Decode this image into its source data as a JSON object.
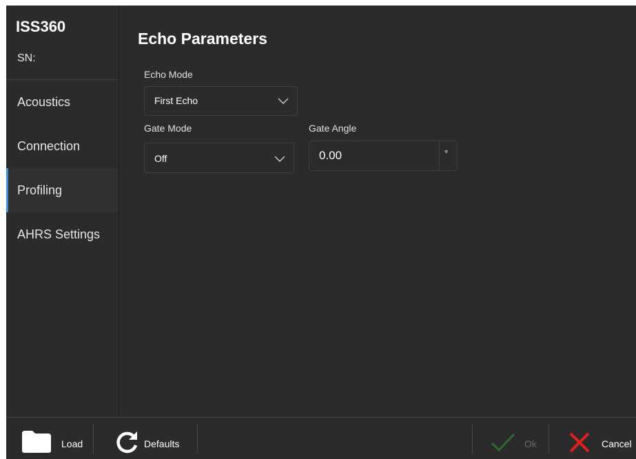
{
  "device": {
    "name": "ISS360",
    "sn": "SN:"
  },
  "sidebar": {
    "items": [
      {
        "label": "Acoustics",
        "active": false
      },
      {
        "label": "Connection",
        "active": false
      },
      {
        "label": "Profiling",
        "active": true
      },
      {
        "label": "AHRS Settings",
        "active": false
      }
    ],
    "accent": "#3a8fd8"
  },
  "panel": {
    "title": "Echo Parameters",
    "echo_mode": {
      "label": "Echo Mode",
      "value": "First Echo"
    },
    "gate_mode": {
      "label": "Gate Mode",
      "value": "Off"
    },
    "gate_angle": {
      "label": "Gate Angle",
      "value": "0.00",
      "unit": "°"
    }
  },
  "toolbar": {
    "load_label": "Load",
    "defaults_label": "Defaults",
    "ok_label": "Ok",
    "cancel_label": "Cancel",
    "icons": {
      "load": "folder-icon",
      "defaults": "refresh-icon",
      "ok": "checkmark-icon",
      "cancel": "close-icon"
    },
    "colors": {
      "ok": "#2e6b2e",
      "cancel": "#e02020"
    }
  }
}
